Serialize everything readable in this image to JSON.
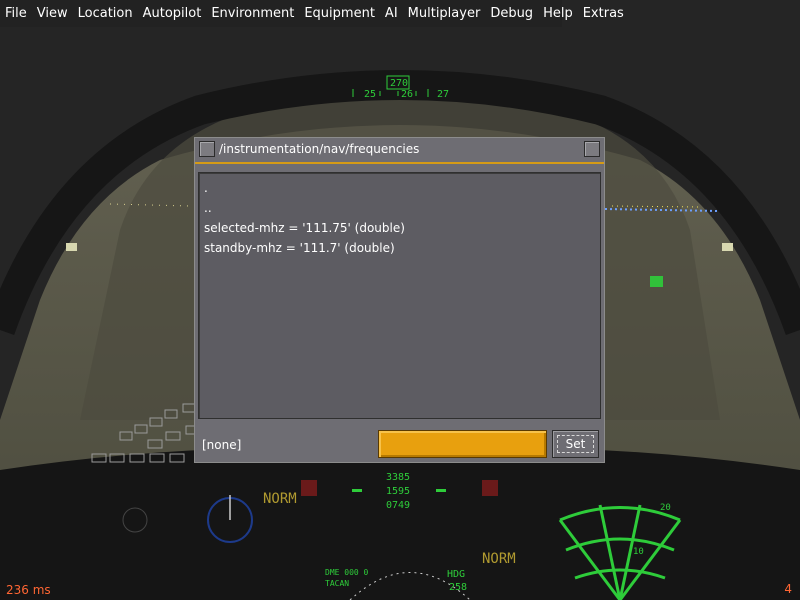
{
  "menu": {
    "items": [
      "File",
      "View",
      "Location",
      "Autopilot",
      "Environment",
      "Equipment",
      "AI",
      "Multiplayer",
      "Debug",
      "Help",
      "Extras"
    ]
  },
  "hud": {
    "heading_box": "270",
    "heading_left": "25",
    "heading_center": "26",
    "heading_right": "27"
  },
  "dialog": {
    "title": "/instrumentation/nav/frequencies",
    "entries": [
      ".",
      "..",
      "selected-mhz = '111.75' (double)",
      "standby-mhz = '111.7' (double)"
    ],
    "status": "[none]",
    "value_field": "",
    "set_label": "Set"
  },
  "cockpit": {
    "norm_left": "NORM",
    "norm_right": "NORM",
    "fuel_readouts": [
      "3385",
      "1595",
      "0749"
    ],
    "dme": "DME 000 0",
    "tacan": "TACAN",
    "hdg_label": "HDG",
    "hdg_value": "258",
    "radar_range_outer": "20",
    "radar_range_inner": "10"
  },
  "overlay": {
    "frame_time": "236 ms",
    "frame_rate": "4"
  },
  "colors": {
    "hud_green": "#2ecc3a",
    "dialog_bg": "#6e6d73",
    "accent_orange": "#e8a00e",
    "stats_orange": "#ff6633"
  }
}
